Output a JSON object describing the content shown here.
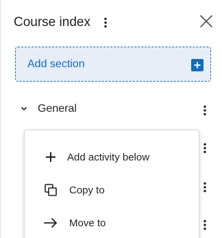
{
  "header": {
    "title": "Course index"
  },
  "add_section": {
    "label": "Add section"
  },
  "sections": [
    {
      "label": "General",
      "expanded": true
    }
  ],
  "menu": {
    "items": [
      {
        "label": "Add activity below",
        "icon": "plus-icon"
      },
      {
        "label": "Copy to",
        "icon": "copy-icon"
      },
      {
        "label": "Move to",
        "icon": "arrow-right-icon"
      }
    ]
  },
  "colors": {
    "accent": "#0f6cbf",
    "accent_bg": "#e7eef8",
    "text": "#1d2125"
  }
}
